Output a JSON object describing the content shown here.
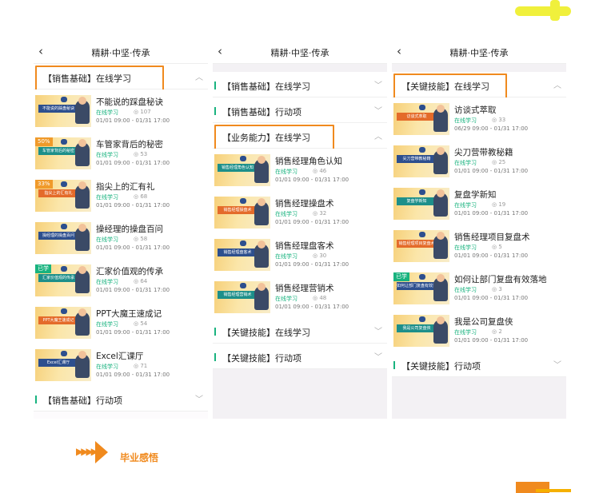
{
  "panels": [
    {
      "title": "精耕·中坚·传承",
      "sections": [
        {
          "label": "【销售基础】在线学习",
          "chevron": "^",
          "highlight": true,
          "items": [
            {
              "name": "不能说的踩盘秘诀",
              "status": "在线学习",
              "views": "107",
              "date": "01/01 09:00 - 01/31 17:00",
              "badge": "",
              "banner": "不能说的踩盘秘诀"
            },
            {
              "name": "车管家背后的秘密",
              "status": "在线学习",
              "views": "53",
              "date": "01/01 09:00 - 01/31 17:00",
              "badge": "50%",
              "banner": "车管家背后的秘密"
            },
            {
              "name": "指尖上的汇有礼",
              "status": "在线学习",
              "views": "68",
              "date": "01/01 09:00 - 01/31 17:00",
              "badge": "33%",
              "banner": "指尖上的汇有礼"
            },
            {
              "name": "操经理的操盘百问",
              "status": "在线学习",
              "views": "58",
              "date": "01/01 09:00 - 01/31 17:00",
              "badge": "",
              "banner": "操经理的操盘百问"
            },
            {
              "name": "汇家价值观的传承",
              "status": "在线学习",
              "views": "64",
              "date": "01/01 09:00 - 01/31 17:00",
              "badge": "已学",
              "banner": "汇家价值观的传承"
            },
            {
              "name": "PPT大魔王速成记",
              "status": "在线学习",
              "views": "54",
              "date": "01/01 09:00 - 01/31 17:00",
              "badge": "",
              "banner": "PPT大魔王速成记"
            },
            {
              "name": "Excel汇课厅",
              "status": "在线学习",
              "views": "71",
              "date": "01/01 09:00 - 01/31 17:00",
              "badge": "",
              "banner": "Excel汇课厅"
            }
          ]
        },
        {
          "label": "【销售基础】行动项",
          "chevron": "v",
          "highlight": false,
          "items": []
        }
      ]
    },
    {
      "title": "精耕·中坚·传承",
      "sections": [
        {
          "label": "【销售基础】在线学习",
          "chevron": "v",
          "highlight": false,
          "items": []
        },
        {
          "label": "【销售基础】行动项",
          "chevron": "v",
          "highlight": false,
          "items": []
        },
        {
          "label": "【业务能力】在线学习",
          "chevron": "^",
          "highlight": true,
          "items": [
            {
              "name": "销售经理角色认知",
              "status": "在线学习",
              "views": "46",
              "date": "01/01 09:00 - 01/31 17:00",
              "badge": "",
              "banner": "销售经理角色认知"
            },
            {
              "name": "销售经理操盘术",
              "status": "在线学习",
              "views": "32",
              "date": "01/01 09:00 - 01/31 17:00",
              "badge": "",
              "banner": "销售经理操盘术"
            },
            {
              "name": "销售经理盘客术",
              "status": "在线学习",
              "views": "30",
              "date": "01/01 09:00 - 01/31 17:00",
              "badge": "",
              "banner": "销售经理盘客术"
            },
            {
              "name": "销售经理营销术",
              "status": "在线学习",
              "views": "48",
              "date": "01/01 09:00 - 01/31 17:00",
              "badge": "",
              "banner": "销售经理营销术"
            }
          ]
        },
        {
          "label": "【关键技能】在线学习",
          "chevron": "v",
          "highlight": false,
          "items": []
        },
        {
          "label": "【关键技能】行动项",
          "chevron": "v",
          "highlight": false,
          "items": []
        }
      ]
    },
    {
      "title": "精耕·中坚·传承",
      "sections": [
        {
          "label": "【关键技能】在线学习",
          "chevron": "^",
          "highlight": true,
          "items": [
            {
              "name": "访谈式萃取",
              "status": "在线学习",
              "views": "33",
              "date": "06/29 09:00 - 01/31 17:00",
              "badge": "",
              "banner": "访谈式萃取"
            },
            {
              "name": "尖刀营带教秘籍",
              "status": "在线学习",
              "views": "25",
              "date": "01/01 09:00 - 01/31 17:00",
              "badge": "",
              "banner": "尖刀营带教秘籍"
            },
            {
              "name": "复盘学新知",
              "status": "在线学习",
              "views": "19",
              "date": "01/01 09:00 - 01/31 17:00",
              "badge": "",
              "banner": "复盘学新知"
            },
            {
              "name": "销售经理项目复盘术",
              "status": "在线学习",
              "views": "5",
              "date": "01/01 09:00 - 01/31 17:00",
              "badge": "",
              "banner": "销售经理项目复盘术"
            },
            {
              "name": "如何让部门复盘有效落地",
              "status": "在线学习",
              "views": "3",
              "date": "01/01 09:00 - 01/31 17:00",
              "badge": "已学",
              "banner": "如何让部门复盘有效落地"
            },
            {
              "name": "我是公司复盘侠",
              "status": "在线学习",
              "views": "2",
              "date": "01/01 09:00 - 01/31 17:00",
              "badge": "",
              "banner": "我是公司复盘侠"
            }
          ]
        },
        {
          "label": "【关键技能】行动项",
          "chevron": "v",
          "highlight": false,
          "items": []
        }
      ]
    }
  ],
  "footer": {
    "label": "毕业感悟",
    "arrows": "▶▶▶▶"
  },
  "icons": {
    "back": "chevron-left-icon",
    "views": "eye-icon",
    "expand": "chevron-icon"
  },
  "colors": {
    "accent": "#19b37f",
    "highlight": "#f08a1e"
  }
}
